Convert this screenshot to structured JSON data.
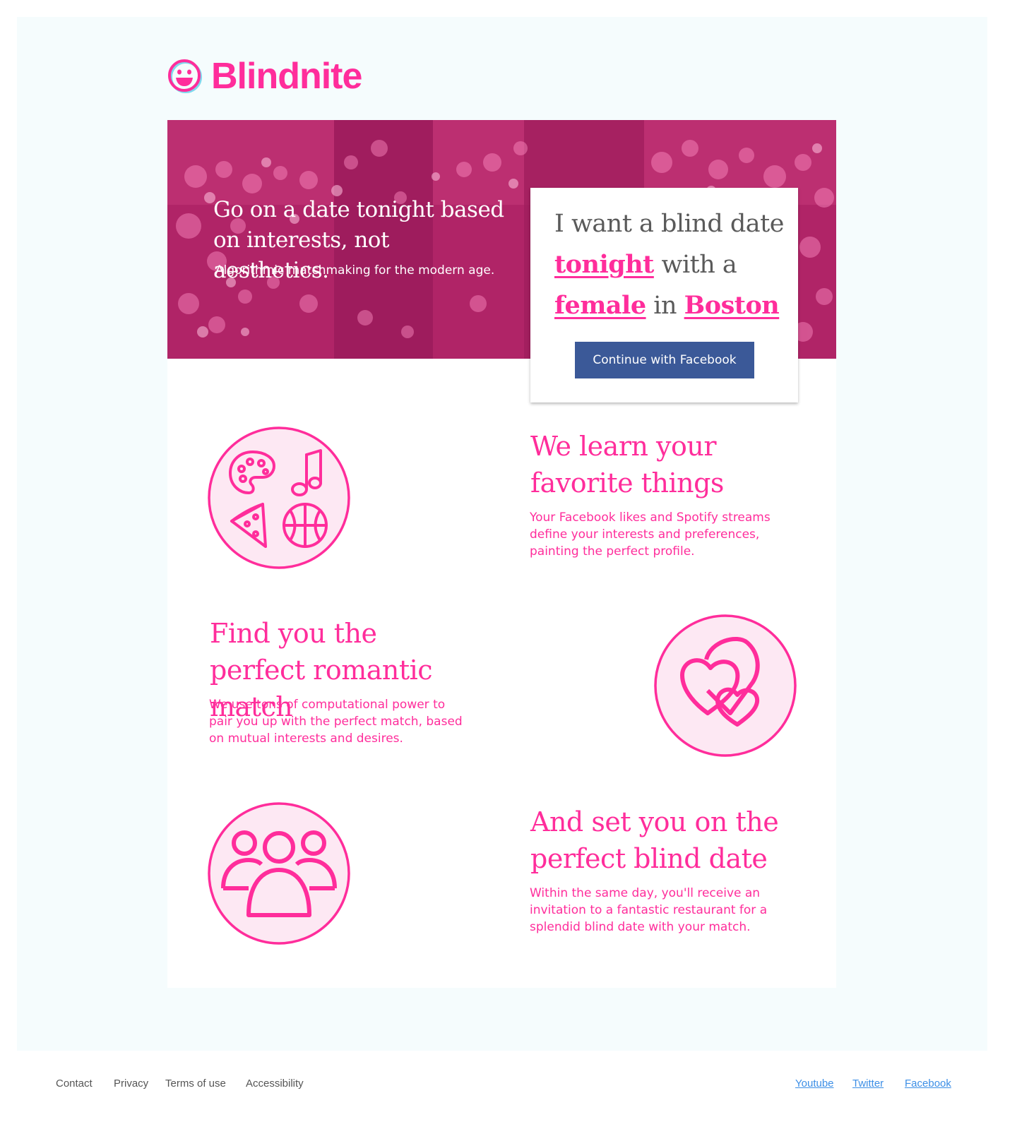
{
  "brand": {
    "name": "Blindnite",
    "accent_color": "#ff2d9b",
    "icon": "smiley-face-icon"
  },
  "hero": {
    "headline": "Go on a date tonight based on interests, not aesthetics.",
    "subheadline": "Algorithmic matchmaking for the modern age."
  },
  "date_form": {
    "prefix": "I want a blind date",
    "when": "tonight",
    "connector1": "with a",
    "gender": "female",
    "connector2": "in",
    "city": "Boston",
    "cta_label": "Continue with Facebook",
    "cta_color": "#3b5998"
  },
  "features": [
    {
      "title": "We learn your favorite things",
      "description": "Your Facebook likes and Spotify streams define your interests and preferences, painting the perfect profile.",
      "icon": "interests-icon"
    },
    {
      "title": "Find you the perfect romantic match",
      "description": "We use tons of computational power to pair you up with the perfect match, based on mutual interests and desires.",
      "icon": "hearts-icon"
    },
    {
      "title": "And set you on the perfect blind date",
      "description": "Within the same day, you'll receive an invitation to a fantastic restaurant for a splendid blind date with your match.",
      "icon": "people-group-icon"
    }
  ],
  "footer": {
    "left_links": [
      "Contact",
      "Privacy",
      "Terms of use",
      "Accessibility"
    ],
    "right_links": [
      "Youtube",
      "Twitter",
      "Facebook"
    ]
  }
}
